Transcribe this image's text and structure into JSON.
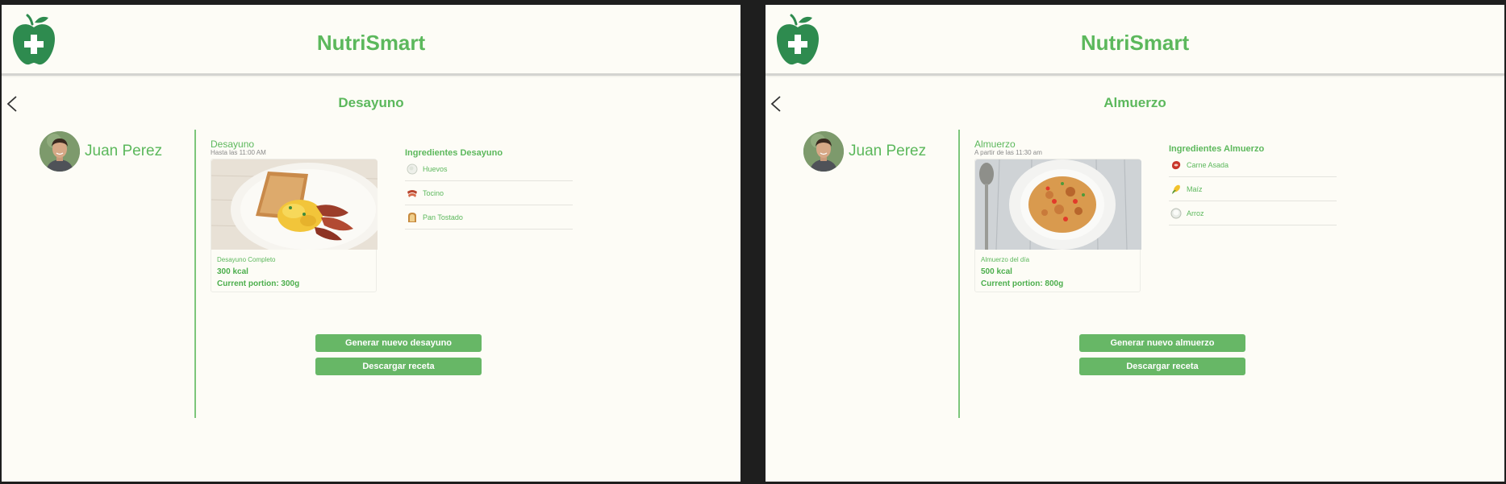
{
  "colors": {
    "brand": "#5cb85c",
    "button": "#67b766",
    "background": "#fdfcf6"
  },
  "screens": [
    {
      "app_title": "NutriSmart",
      "logo_icon": "apple-medical-cross-icon",
      "back_icon": "chevron-left-icon",
      "page_title": "Desayuno",
      "user": {
        "name": "Juan Perez",
        "avatar_icon": "user-avatar"
      },
      "meal": {
        "name": "Desayuno",
        "time": "Hasta las 11:00 AM",
        "image_icon": "breakfast-plate-image",
        "description": "Desayuno Completo",
        "kcal": "300 kcal",
        "portion": "Current portion: 300g"
      },
      "ingredients_title": "Ingredientes Desayuno",
      "ingredients": [
        {
          "label": "Huevos",
          "icon": "egg-icon"
        },
        {
          "label": "Tocino",
          "icon": "bacon-icon"
        },
        {
          "label": "Pan Tostado",
          "icon": "toast-icon"
        }
      ],
      "buttons": {
        "generate": "Generar nuevo desayuno",
        "download": "Descargar receta"
      }
    },
    {
      "app_title": "NutriSmart",
      "logo_icon": "apple-medical-cross-icon",
      "back_icon": "chevron-left-icon",
      "page_title": "Almuerzo",
      "user": {
        "name": "Juan Perez",
        "avatar_icon": "user-avatar"
      },
      "meal": {
        "name": "Almuerzo",
        "time": "A partir de las 11:30 am",
        "image_icon": "rice-dish-image",
        "description": "Almuerzo del día",
        "kcal": "500 kcal",
        "portion": "Current portion: 800g"
      },
      "ingredients_title": "Ingredientes Almuerzo",
      "ingredients": [
        {
          "label": "Carne Asada",
          "icon": "steak-icon"
        },
        {
          "label": "Maíz",
          "icon": "corn-icon"
        },
        {
          "label": "Arroz",
          "icon": "rice-icon"
        }
      ],
      "buttons": {
        "generate": "Generar nuevo almuerzo",
        "download": "Descargar receta"
      }
    }
  ]
}
